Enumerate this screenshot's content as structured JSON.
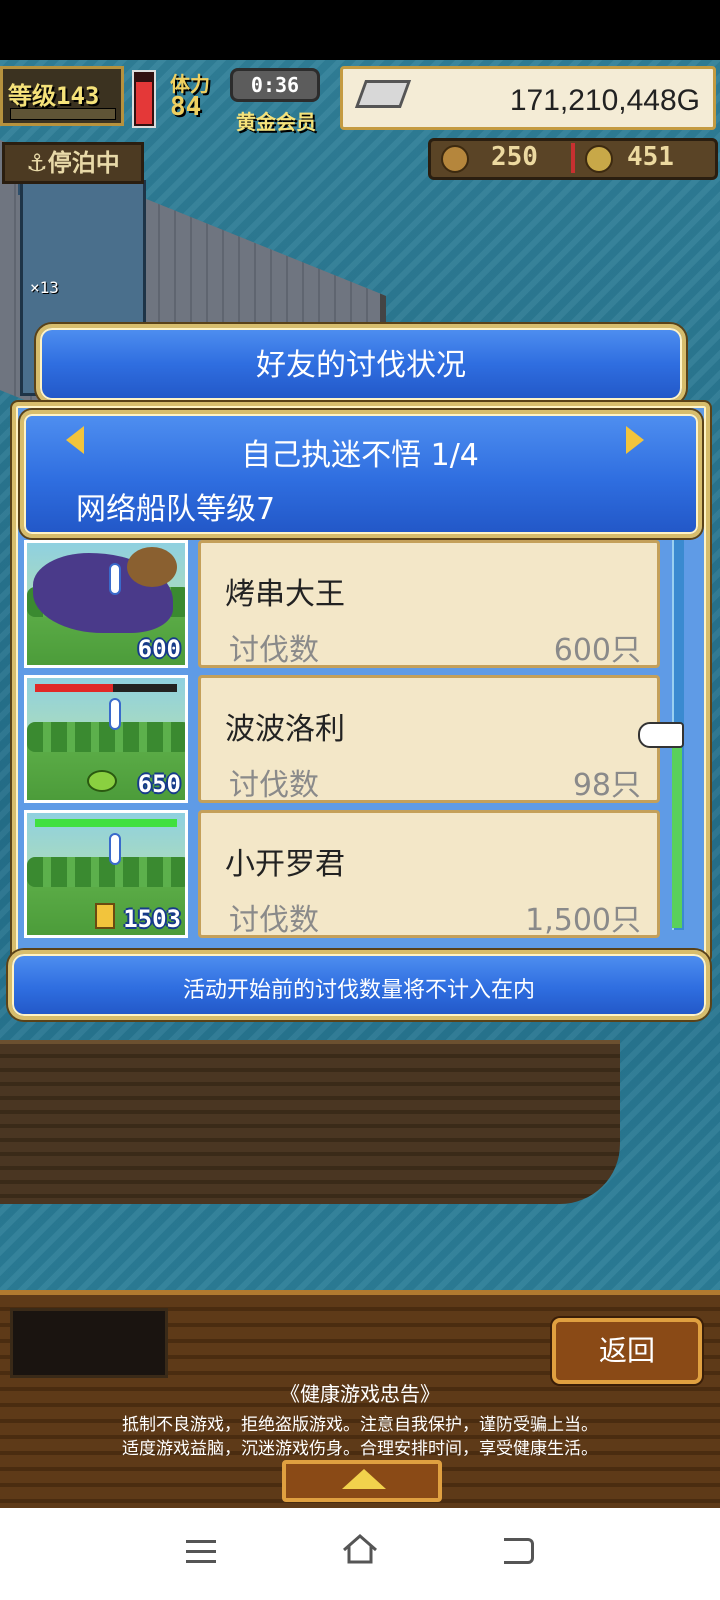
{
  "hud": {
    "level_label": "等级143",
    "stamina_label": "体力",
    "stamina_value": "84",
    "timer": "0:36",
    "membership": "黄金会员",
    "money": "171,210,448G",
    "status": "停泊中",
    "resource_1": "250",
    "resource_2": "451",
    "map_marker": "×13",
    "hp_fraction": 0.8
  },
  "dialog": {
    "title": "好友的讨伐状况",
    "player_name": "自己执迷不悟 1/4",
    "fleet_level": "网络船队等级7",
    "rows": [
      {
        "thumb_count": "600",
        "name": "烤串大王",
        "label": "讨伐数",
        "value": "600只",
        "hp_fraction": 0
      },
      {
        "thumb_count": "650",
        "name": "波波洛利",
        "label": "讨伐数",
        "value": "98只",
        "hp_fraction": 0.55
      },
      {
        "thumb_count": "1503",
        "name": "小开罗君",
        "label": "讨伐数",
        "value": "1,500只",
        "hp_fraction": 1
      }
    ],
    "notice": "活动开始前的讨伐数量将不计入在内"
  },
  "bottom": {
    "back_label": "返回",
    "advice_title": "《健康游戏忠告》",
    "advice_line1": "抵制不良游戏，拒绝盗版游戏。注意自我保护，谨防受骗上当。",
    "advice_line2": "适度游戏益脑，沉迷游戏伤身。合理安排时间，享受健康生活。"
  },
  "colors": {
    "accent_blue": "#2f6ee0",
    "gold": "#d7bd6c",
    "parchment": "#f3e7c8"
  }
}
